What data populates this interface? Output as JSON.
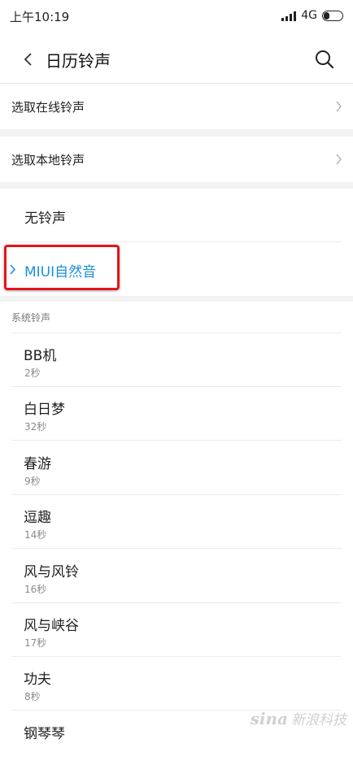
{
  "status_bar": {
    "time": "上午10:19",
    "network": "4G",
    "network_sub": "ıl"
  },
  "header": {
    "title": "日历铃声"
  },
  "links": [
    {
      "label": "选取在线铃声"
    },
    {
      "label": "选取本地铃声"
    }
  ],
  "options": {
    "none": "无铃声",
    "selected": "MIUI自然音"
  },
  "section": {
    "title": "系统铃声"
  },
  "tones": [
    {
      "name": "BB机",
      "duration": "2秒"
    },
    {
      "name": "白日梦",
      "duration": "32秒"
    },
    {
      "name": "春游",
      "duration": "9秒"
    },
    {
      "name": "逗趣",
      "duration": "14秒"
    },
    {
      "name": "风与风铃",
      "duration": "16秒"
    },
    {
      "name": "风与峡谷",
      "duration": "17秒"
    },
    {
      "name": "功夫",
      "duration": "8秒"
    },
    {
      "name": "钢琴琴",
      "duration": ""
    }
  ],
  "watermark": {
    "logo": "sina",
    "text": "新浪科技"
  },
  "colors": {
    "accent": "#1a8fdc",
    "highlight_box": "#e5141b"
  }
}
